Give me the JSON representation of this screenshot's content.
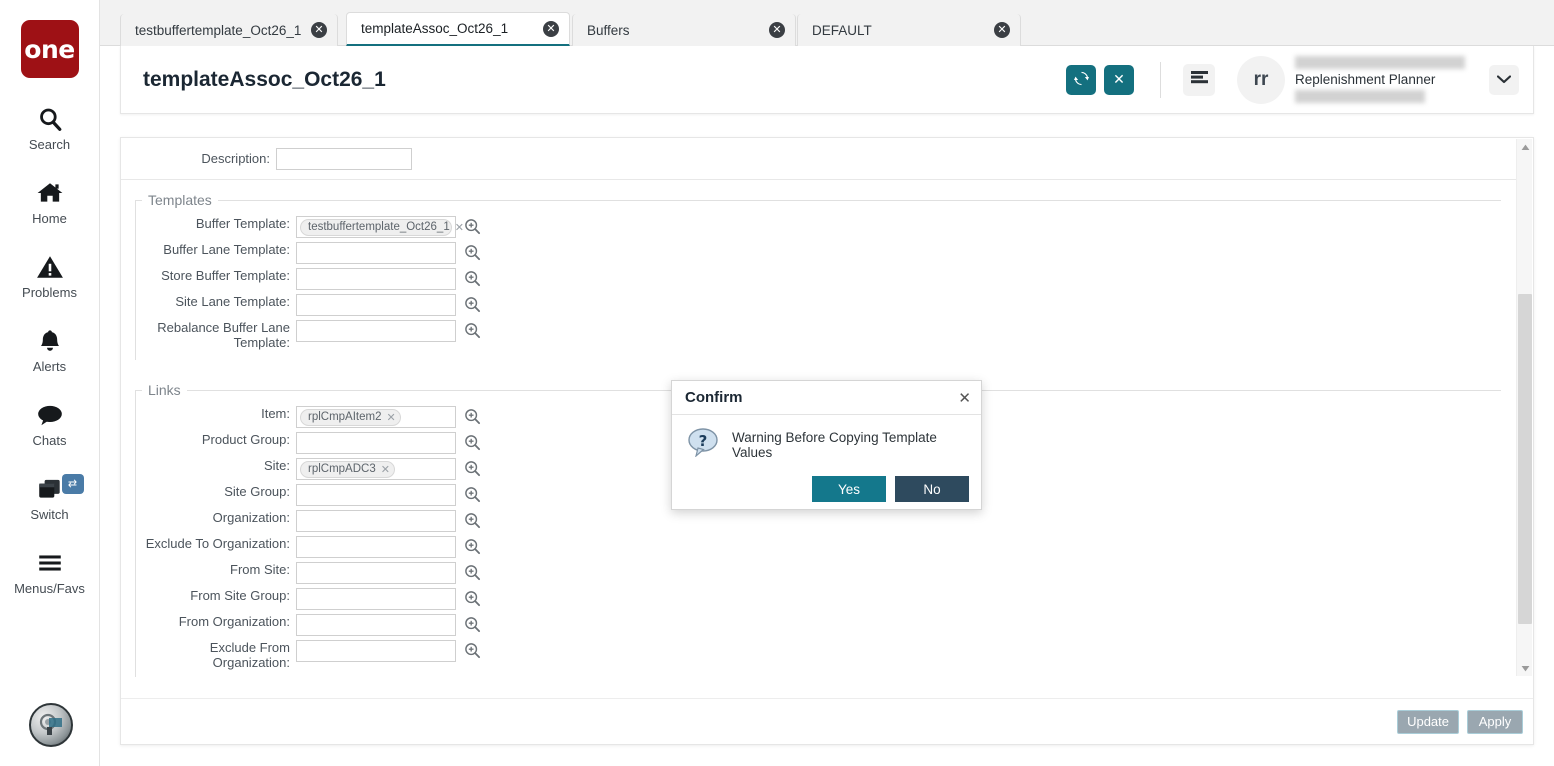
{
  "app": {
    "logo_text": "one"
  },
  "sidebar": {
    "items": [
      {
        "label": "Search",
        "icon": "search-icon"
      },
      {
        "label": "Home",
        "icon": "home-icon"
      },
      {
        "label": "Problems",
        "icon": "warning-triangle-icon"
      },
      {
        "label": "Alerts",
        "icon": "bell-icon"
      },
      {
        "label": "Chats",
        "icon": "chat-bubble-icon"
      },
      {
        "label": "Switch",
        "icon": "switch-windows-icon",
        "badge": "⇄"
      },
      {
        "label": "Menus/Favs",
        "icon": "hamburger-icon"
      }
    ],
    "bottom_icon": "globe-network-icon"
  },
  "tabs": [
    {
      "label": "testbuffertemplate_Oct26_1",
      "active": false,
      "close": "✕"
    },
    {
      "label": "templateAssoc_Oct26_1",
      "active": true,
      "close": "✕"
    },
    {
      "label": "Buffers",
      "active": false,
      "close": "✕"
    },
    {
      "label": "DEFAULT",
      "active": false,
      "close": "✕"
    }
  ],
  "header": {
    "title": "templateAssoc_Oct26_1",
    "refresh_icon": "refresh-icon",
    "close_icon": "close-icon",
    "menu_icon": "hamburger-menu-icon",
    "avatar_initials": "rr",
    "user_role": "Replenishment Planner",
    "chevron_icon": "chevron-down-icon",
    "accent_teal": "#14707f"
  },
  "form": {
    "description": {
      "label": "Description:",
      "value": "",
      "placeholder": ""
    },
    "sections": [
      {
        "legend": "Templates",
        "fields": [
          {
            "label": "Buffer Template:",
            "chip": "testbuffertemplate_Oct26_1",
            "chip_close": "✕",
            "lookup": "lookup-icon"
          },
          {
            "label": "Buffer Lane Template:",
            "chip": "",
            "lookup": "lookup-icon"
          },
          {
            "label": "Store Buffer Template:",
            "chip": "",
            "lookup": "lookup-icon"
          },
          {
            "label": "Site Lane Template:",
            "chip": "",
            "lookup": "lookup-icon"
          },
          {
            "label": "Rebalance Buffer Lane Template:",
            "chip": "",
            "lookup": "lookup-icon",
            "two_line": true
          }
        ]
      },
      {
        "legend": "Links",
        "fields": [
          {
            "label": "Item:",
            "chip": "rplCmpAItem2",
            "chip_close": "✕",
            "lookup": "lookup-icon"
          },
          {
            "label": "Product Group:",
            "chip": "",
            "lookup": "lookup-icon"
          },
          {
            "label": "Site:",
            "chip": "rplCmpADC3",
            "chip_close": "✕",
            "lookup": "lookup-icon"
          },
          {
            "label": "Site Group:",
            "chip": "",
            "lookup": "lookup-icon"
          },
          {
            "label": "Organization:",
            "chip": "",
            "lookup": "lookup-icon"
          },
          {
            "label": "Exclude To Organization:",
            "chip": "",
            "lookup": "lookup-icon"
          },
          {
            "label": "From Site:",
            "chip": "",
            "lookup": "lookup-icon"
          },
          {
            "label": "From Site Group:",
            "chip": "",
            "lookup": "lookup-icon"
          },
          {
            "label": "From Organization:",
            "chip": "",
            "lookup": "lookup-icon"
          },
          {
            "label": "Exclude From Organization:",
            "chip": "",
            "lookup": "lookup-icon",
            "two_line": true
          }
        ]
      }
    ]
  },
  "footer": {
    "update_label": "Update",
    "apply_label": "Apply"
  },
  "dialog": {
    "title": "Confirm",
    "close": "✕",
    "icon": "question-bubble-icon",
    "message": "Warning Before Copying Template Values",
    "yes_label": "Yes",
    "no_label": "No",
    "yes_color": "#14788c",
    "no_color": "#2e4a5e"
  },
  "scrollbars": {
    "v_up": "▲",
    "v_down": "▼",
    "h_left": "◀",
    "h_right": "▶"
  }
}
